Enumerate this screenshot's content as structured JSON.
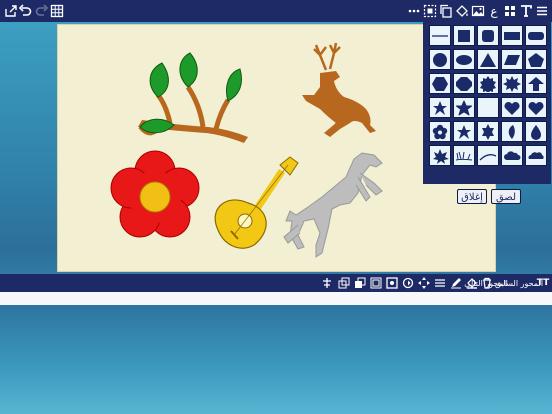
{
  "toolbar_top": {
    "left_icons": [
      "share-icon",
      "undo-icon",
      "redo-icon",
      "grid-icon"
    ],
    "right_icons": [
      "more-icon",
      "select-icon",
      "copy-icon",
      "fill-icon",
      "image-icon",
      "arabic-letter-icon",
      "apps-icon",
      "text-icon",
      "menu-icon"
    ],
    "arabic_glyph": "ع"
  },
  "shapes_panel": {
    "paste_label": "لصق",
    "close_label": "إغلاق"
  },
  "toolbar_bottom": {
    "text_size_icon": "TT",
    "prev_label": "المحور السابق",
    "next_label": "المحور التالي"
  },
  "colors": {
    "bar": "#1e2a66",
    "canvas": "#f2efd2",
    "shape_fill": "#1b2a68",
    "leaf": "#1e9a2a",
    "branch": "#b8671e",
    "deer": "#b8671e",
    "flower": "#e81818",
    "flower_center": "#f2c014",
    "oud": "#f2c814",
    "horse": "#bdbdbd"
  }
}
